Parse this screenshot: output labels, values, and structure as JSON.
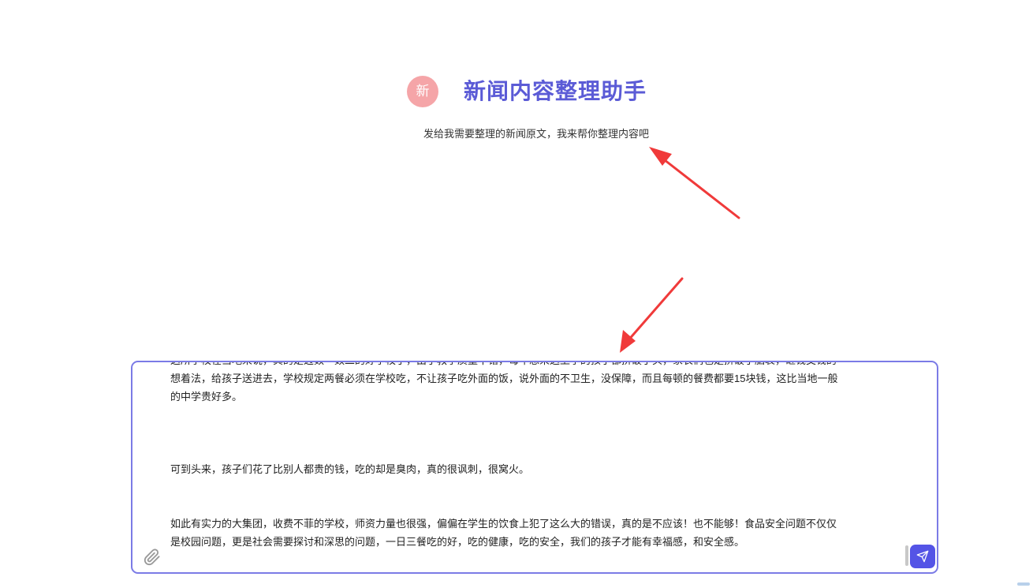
{
  "header": {
    "avatar_text": "新",
    "title": "新闻内容整理助手",
    "subtitle": "发给我需要整理的新闻原文，我来帮你整理内容吧"
  },
  "input": {
    "paragraphs": [
      "这所学校在当地来说，真的是迈数一数二的好学校了，由于教学质量不错，每年想来这上学的孩子都挤破了头，家长们也是挤破了脑袋，砸钱交钱的",
      "想着法，给孩子送进去，学校规定两餐必须在学校吃，不让孩子吃外面的饭，说外面的不卫生，没保障，而且每顿的餐费都要15块钱，这比当地一般",
      "的中学贵好多。",
      "可到头来，孩子们花了比别人都贵的钱，吃的却是臭肉，真的很讽刺，很窝火。",
      "如此有实力的大集团，收费不菲的学校，师资力量也很强，偏偏在学生的饮食上犯了这么大的错误，真的是不应该！也不能够！食品安全问题不仅仅",
      "是校园问题，更是社会需要探讨和深思的问题，一日三餐吃的好，吃的健康，吃的安全，我们的孩子才能有幸福感，和安全感。"
    ]
  },
  "icons": {
    "attach": "paperclip-icon",
    "send": "send-icon"
  },
  "colors": {
    "accent": "#5b5bd6",
    "avatar_bg": "#f5a5a8",
    "send_bg": "#5454e6",
    "border": "#7b7be6",
    "arrow": "#f03a3a"
  }
}
